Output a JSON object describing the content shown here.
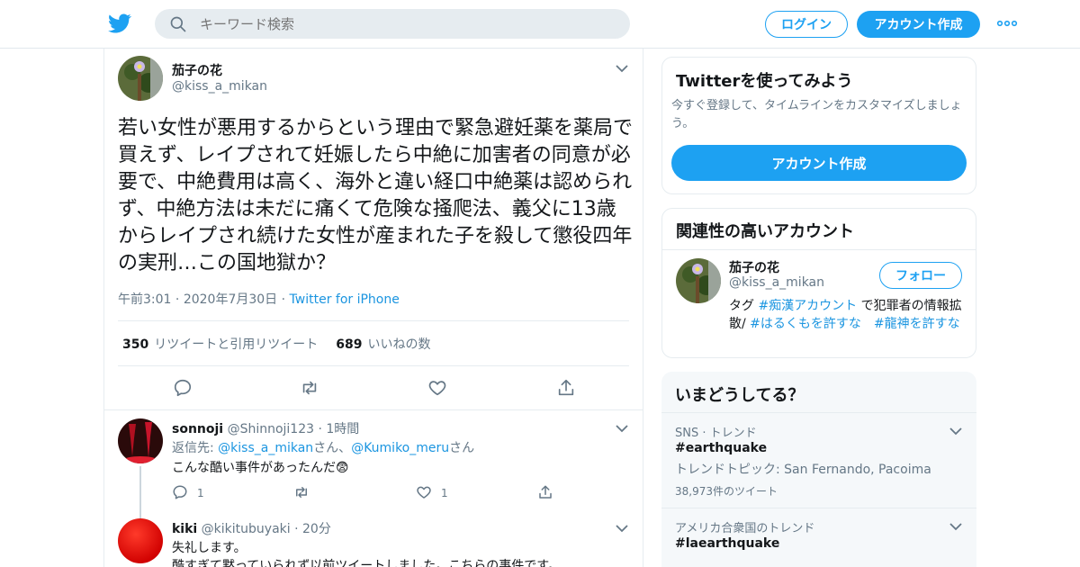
{
  "header": {
    "search_placeholder": "キーワード検索",
    "login_label": "ログイン",
    "signup_label": "アカウント作成"
  },
  "tweet": {
    "author_name": "茄子の花",
    "author_handle": "@kiss_a_mikan",
    "text": "若い女性が悪用するからという理由で緊急避妊薬を薬局で買えず、レイプされて妊娠したら中絶に加害者の同意が必要で、中絶費用は高く、海外と違い経口中絶薬は認められず、中絶方法は未だに痛くて危険な掻爬法、義父に13歳からレイプされ続けた女性が産まれた子を殺して懲役四年の実刑…この国地獄か？",
    "time": "午前3:01",
    "date": "2020年7月30日",
    "source": "Twitter for iPhone",
    "retweets_count": "350",
    "retweets_label": "リツイートと引用リツイート",
    "likes_count": "689",
    "likes_label": "いいねの数"
  },
  "replies": [
    {
      "name": "sonnoji",
      "handle": "@Shinnoji123",
      "time": "1時間",
      "reply_to_prefix": "返信先: ",
      "reply_to_1": "@kiss_a_mikan",
      "reply_to_mid": "さん、",
      "reply_to_2": "@Kumiko_meru",
      "reply_to_suffix": "さん",
      "text": "こんな酷い事件があったんだ😨",
      "reply_count": "1",
      "like_count": "1"
    },
    {
      "name": "kiki",
      "handle": "@kikitubuyaki",
      "time": "20分",
      "text_line1": "失礼します。",
      "text_line2": "酷すぎて黙っていられず以前ツイートしました。こちらの事件です。"
    }
  ],
  "signup_card": {
    "title": "Twitterを使ってみよう",
    "desc": "今すぐ登録して、タイムラインをカスタマイズしましょう。",
    "button": "アカウント作成"
  },
  "related_card": {
    "title": "関連性の高いアカウント",
    "name": "茄子の花",
    "handle": "@kiss_a_mikan",
    "follow_label": "フォロー",
    "bio_1": "タグ ",
    "bio_tag1": "#痴漢アカウント",
    "bio_2": " で犯罪者の情報拡散/ ",
    "bio_tag2": "#はるくもを許すな",
    "bio_3": "　",
    "bio_tag3": "#龍神を許すな"
  },
  "trends": {
    "title": "いまどうしてる？",
    "items": [
      {
        "context": "SNS · トレンド",
        "name": "#earthquake",
        "topics": "トレンドトピック: San Fernando, Pacoima",
        "count": "38,973件のツイート"
      },
      {
        "context": "アメリカ合衆国のトレンド",
        "name": "#laearthquake"
      }
    ]
  },
  "colors": {
    "brand": "#1da1f2",
    "link": "#1b95e0",
    "muted": "#657786"
  }
}
